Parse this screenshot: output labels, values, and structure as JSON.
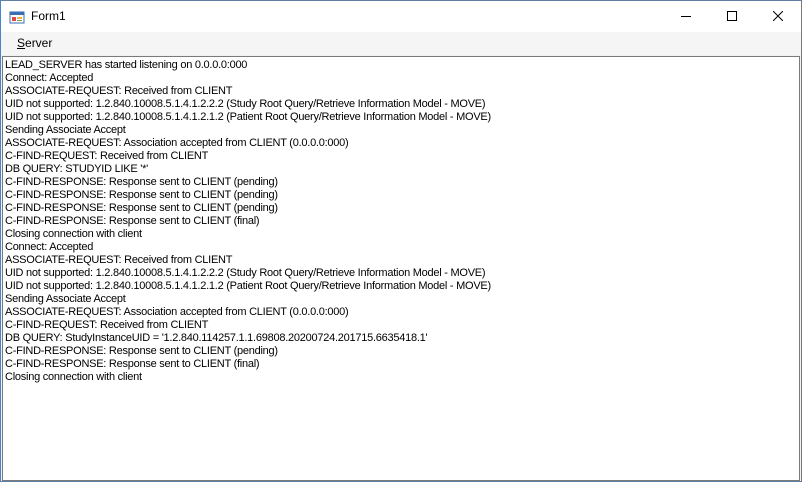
{
  "window": {
    "title": "Form1",
    "controls": {
      "minimize": "minimize-icon",
      "maximize": "maximize-icon",
      "close": "close-icon"
    }
  },
  "menu": {
    "items": [
      {
        "mnemonic": "S",
        "rest": "erver"
      }
    ]
  },
  "log": {
    "lines": [
      "LEAD_SERVER has started listening on 0.0.0.0:000",
      "Connect: Accepted",
      "ASSOCIATE-REQUEST: Received from CLIENT",
      "UID not supported: 1.2.840.10008.5.1.4.1.2.2.2 (Study Root Query/Retrieve Information Model - MOVE)",
      "UID not supported: 1.2.840.10008.5.1.4.1.2.1.2 (Patient Root Query/Retrieve Information Model - MOVE)",
      "Sending Associate Accept",
      "ASSOCIATE-REQUEST: Association accepted from CLIENT (0.0.0.0:000)",
      "C-FIND-REQUEST: Received from CLIENT",
      "DB QUERY: STUDYID LIKE '*'",
      "C-FIND-RESPONSE: Response sent to CLIENT (pending)",
      "C-FIND-RESPONSE: Response sent to CLIENT (pending)",
      "C-FIND-RESPONSE: Response sent to CLIENT (pending)",
      "C-FIND-RESPONSE: Response sent to CLIENT (final)",
      "Closing connection with client",
      "Connect: Accepted",
      "ASSOCIATE-REQUEST: Received from CLIENT",
      "UID not supported: 1.2.840.10008.5.1.4.1.2.2.2 (Study Root Query/Retrieve Information Model - MOVE)",
      "UID not supported: 1.2.840.10008.5.1.4.1.2.1.2 (Patient Root Query/Retrieve Information Model - MOVE)",
      "Sending Associate Accept",
      "ASSOCIATE-REQUEST: Association accepted from CLIENT (0.0.0.0:000)",
      "C-FIND-REQUEST: Received from CLIENT",
      "DB QUERY: StudyInstanceUID = '1.2.840.114257.1.1.69808.20200724.201715.6635418.1'",
      "C-FIND-RESPONSE: Response sent to CLIENT (pending)",
      "C-FIND-RESPONSE: Response sent to CLIENT (final)",
      "Closing connection with client"
    ]
  }
}
